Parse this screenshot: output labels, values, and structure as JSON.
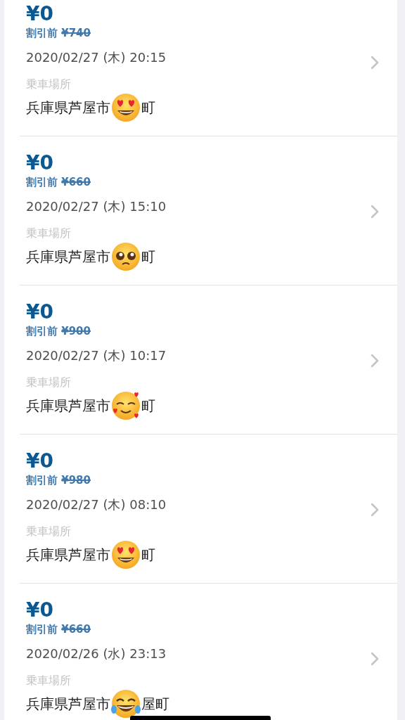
{
  "rides": [
    {
      "fare": "¥0",
      "discount_label": "割引前",
      "original_fare": "¥740",
      "datetime": "2020/02/27 (木) 20:15",
      "place_label": "乗車場所",
      "place_before": "兵庫県芦屋市",
      "place_after": "町",
      "sticker": {
        "kind": "heart-eyes"
      }
    },
    {
      "fare": "¥0",
      "discount_label": "割引前",
      "original_fare": "¥660",
      "datetime": "2020/02/27 (木) 15:10",
      "place_label": "乗車場所",
      "place_before": "兵庫県芦屋市",
      "place_after": "町",
      "sticker": {
        "kind": "pleading"
      }
    },
    {
      "fare": "¥0",
      "discount_label": "割引前",
      "original_fare": "¥900",
      "datetime": "2020/02/27 (木) 10:17",
      "place_label": "乗車場所",
      "place_before": "兵庫県芦屋市",
      "place_after": "町",
      "sticker": {
        "kind": "hearts"
      }
    },
    {
      "fare": "¥0",
      "discount_label": "割引前",
      "original_fare": "¥980",
      "datetime": "2020/02/27 (木) 08:10",
      "place_label": "乗車場所",
      "place_before": "兵庫県芦屋市",
      "place_after": "町",
      "sticker": {
        "kind": "heart-eyes"
      }
    },
    {
      "fare": "¥0",
      "discount_label": "割引前",
      "original_fare": "¥660",
      "datetime": "2020/02/26 (水) 23:13",
      "place_label": "乗車場所",
      "place_before": "兵庫県芦屋市",
      "place_after": "屋町",
      "sticker": {
        "kind": "tears-of-joy"
      }
    }
  ]
}
